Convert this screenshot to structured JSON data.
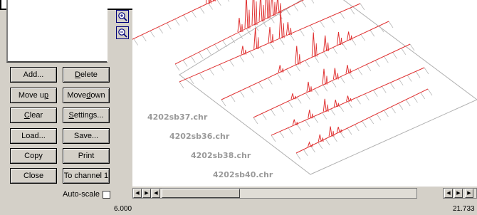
{
  "buttons": {
    "add": "Add...",
    "delete": "Delete",
    "move_up": "Move up",
    "move_down": "Move down",
    "clear": "Clear",
    "settings": "Settings...",
    "load": "Load...",
    "save": "Save...",
    "copy": "Copy",
    "print": "Print",
    "close": "Close",
    "to_channel": "To channel 1"
  },
  "auto_scale": {
    "label": "Auto-scale",
    "checked": false
  },
  "zoom": {
    "in_icon": "zoom-in-icon",
    "out_icon": "zoom-out-icon"
  },
  "plot": {
    "files": [
      "4202sb37.chr",
      "4202sb36.chr",
      "4202sb38.chr",
      "4202sb40.chr"
    ],
    "trace_color": "#e03030"
  },
  "axis": {
    "min": "6.000",
    "max": "21.733"
  }
}
